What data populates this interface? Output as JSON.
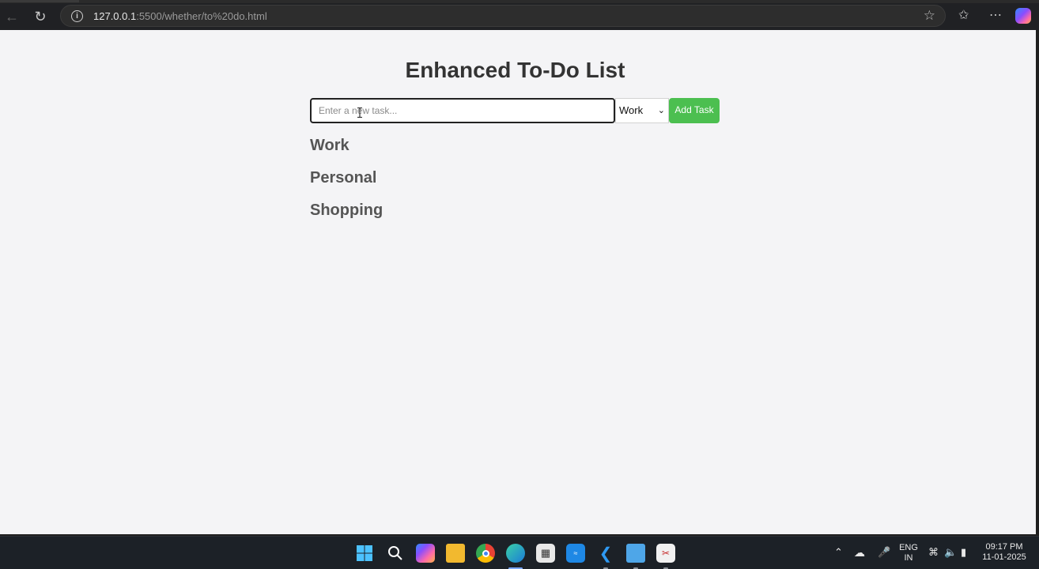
{
  "browser": {
    "url_host": "127.0.0.1",
    "url_rest": ":5500/whether/to%20do.html"
  },
  "page": {
    "title": "Enhanced To-Do List",
    "task_input": {
      "placeholder": "Enter a new task...",
      "value": ""
    },
    "category_select": {
      "selected": "Work"
    },
    "add_button_label": "Add Task",
    "categories": [
      "Work",
      "Personal",
      "Shopping"
    ]
  },
  "taskbar": {
    "language": "ENG",
    "region": "IN",
    "time": "09:17 PM",
    "date": "11-01-2025"
  },
  "colors": {
    "accent": "#4cbf50",
    "page_background": "#f4f4f6"
  }
}
